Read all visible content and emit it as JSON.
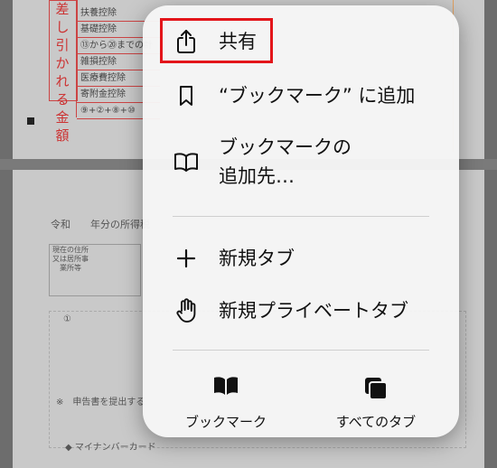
{
  "document": {
    "vertical_red_text": "差し引かれる金額",
    "rows": [
      "扶養控除",
      "基礎控除",
      "⑬から⑳までの計",
      "雑損控除",
      "医療費控除",
      "寄附金控除",
      "⑨+②+⑧+⑩"
    ],
    "era": "令和",
    "year_label": "年分の所得税",
    "address_label": "現在の住所又は居所事業所等",
    "circle_one": "①",
    "note": "※　申告書を提出する",
    "mynumber": "◆ マイナンバーカード"
  },
  "menu": {
    "items": [
      {
        "label": "共有",
        "icon": "share-icon"
      },
      {
        "label": "“ブックマーク” に追加",
        "icon": "bookmark-icon"
      },
      {
        "label": "ブックマークの",
        "label2": "追加先…",
        "icon": "book-open-icon"
      },
      {
        "label": "新規タブ",
        "icon": "plus-icon"
      },
      {
        "label": "新規プライベートタブ",
        "icon": "hand-icon"
      }
    ],
    "bottom": [
      {
        "label": "ブックマーク",
        "icon": "book-filled-icon"
      },
      {
        "label": "すべてのタブ",
        "icon": "tabs-icon"
      }
    ],
    "highlight_color": "#e3151a"
  }
}
